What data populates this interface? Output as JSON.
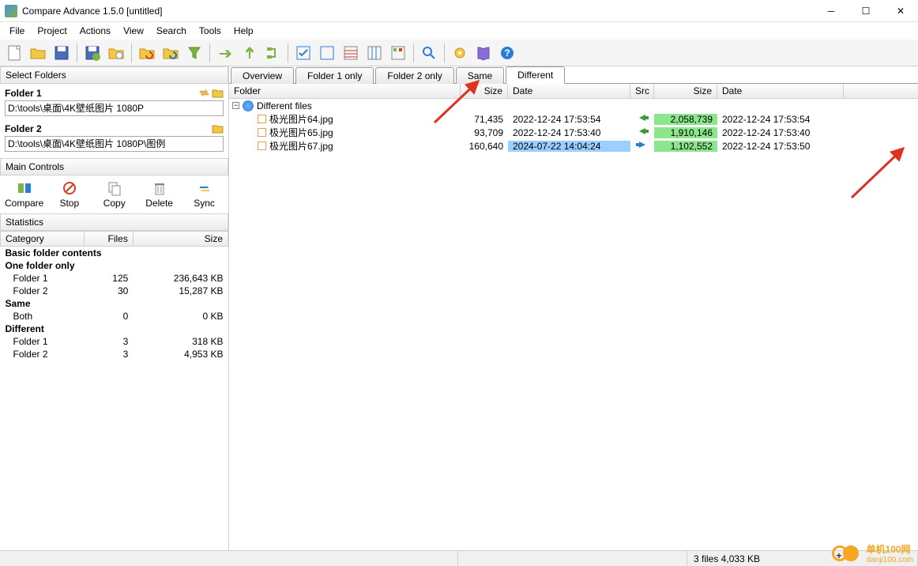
{
  "window": {
    "title": "Compare Advance 1.5.0 [untitled]"
  },
  "menu": [
    "File",
    "Project",
    "Actions",
    "View",
    "Search",
    "Tools",
    "Help"
  ],
  "sidebar": {
    "select_folders": "Select Folders",
    "folder1_label": "Folder 1",
    "folder1_path": "D:\\tools\\桌面\\4K壁纸图片 1080P",
    "folder2_label": "Folder 2",
    "folder2_path": "D:\\tools\\桌面\\4K壁纸图片 1080P\\图例",
    "main_controls": "Main Controls",
    "controls": [
      {
        "label": "Compare"
      },
      {
        "label": "Stop"
      },
      {
        "label": "Copy"
      },
      {
        "label": "Delete"
      },
      {
        "label": "Sync"
      }
    ],
    "statistics": "Statistics",
    "stats_headers": {
      "category": "Category",
      "files": "Files",
      "size": "Size"
    },
    "stats": {
      "basic": "Basic folder contents",
      "one_only": "One folder only",
      "f1": {
        "name": "Folder 1",
        "files": "125",
        "size": "236,643 KB"
      },
      "f2": {
        "name": "Folder 2",
        "files": "30",
        "size": "15,287 KB"
      },
      "same": "Same",
      "both": {
        "name": "Both",
        "files": "0",
        "size": "0 KB"
      },
      "different": "Different",
      "df1": {
        "name": "Folder 1",
        "files": "3",
        "size": "318 KB"
      },
      "df2": {
        "name": "Folder 2",
        "files": "3",
        "size": "4,953 KB"
      }
    }
  },
  "tabs": [
    "Overview",
    "Folder 1 only",
    "Folder 2 only",
    "Same",
    "Different"
  ],
  "active_tab": 4,
  "list_headers": {
    "folder": "Folder",
    "size": "Size",
    "date": "Date",
    "src": "Src",
    "size2": "Size",
    "date2": "Date"
  },
  "group_label": "Different files",
  "rows": [
    {
      "name": "极光图片64.jpg",
      "sz1": "71,435",
      "dt1": "2022-12-24 17:53:54",
      "src": "left",
      "sz2": "2,058,739",
      "dt2": "2022-12-24 17:53:54",
      "hl_sz2": true
    },
    {
      "name": "极光图片65.jpg",
      "sz1": "93,709",
      "dt1": "2022-12-24 17:53:40",
      "src": "left",
      "sz2": "1,910,146",
      "dt2": "2022-12-24 17:53:40",
      "hl_sz2": true
    },
    {
      "name": "极光图片67.jpg",
      "sz1": "160,640",
      "dt1": "2024-07-22 14:04:24",
      "src": "right",
      "sz2": "1,102,552",
      "dt2": "2022-12-24 17:53:50",
      "hl_dt1": true,
      "hl_sz2": true
    }
  ],
  "statusbar": {
    "files": "3 files 4,033 KB"
  },
  "watermark": {
    "name": "单机100网",
    "url": "danji100.com"
  }
}
